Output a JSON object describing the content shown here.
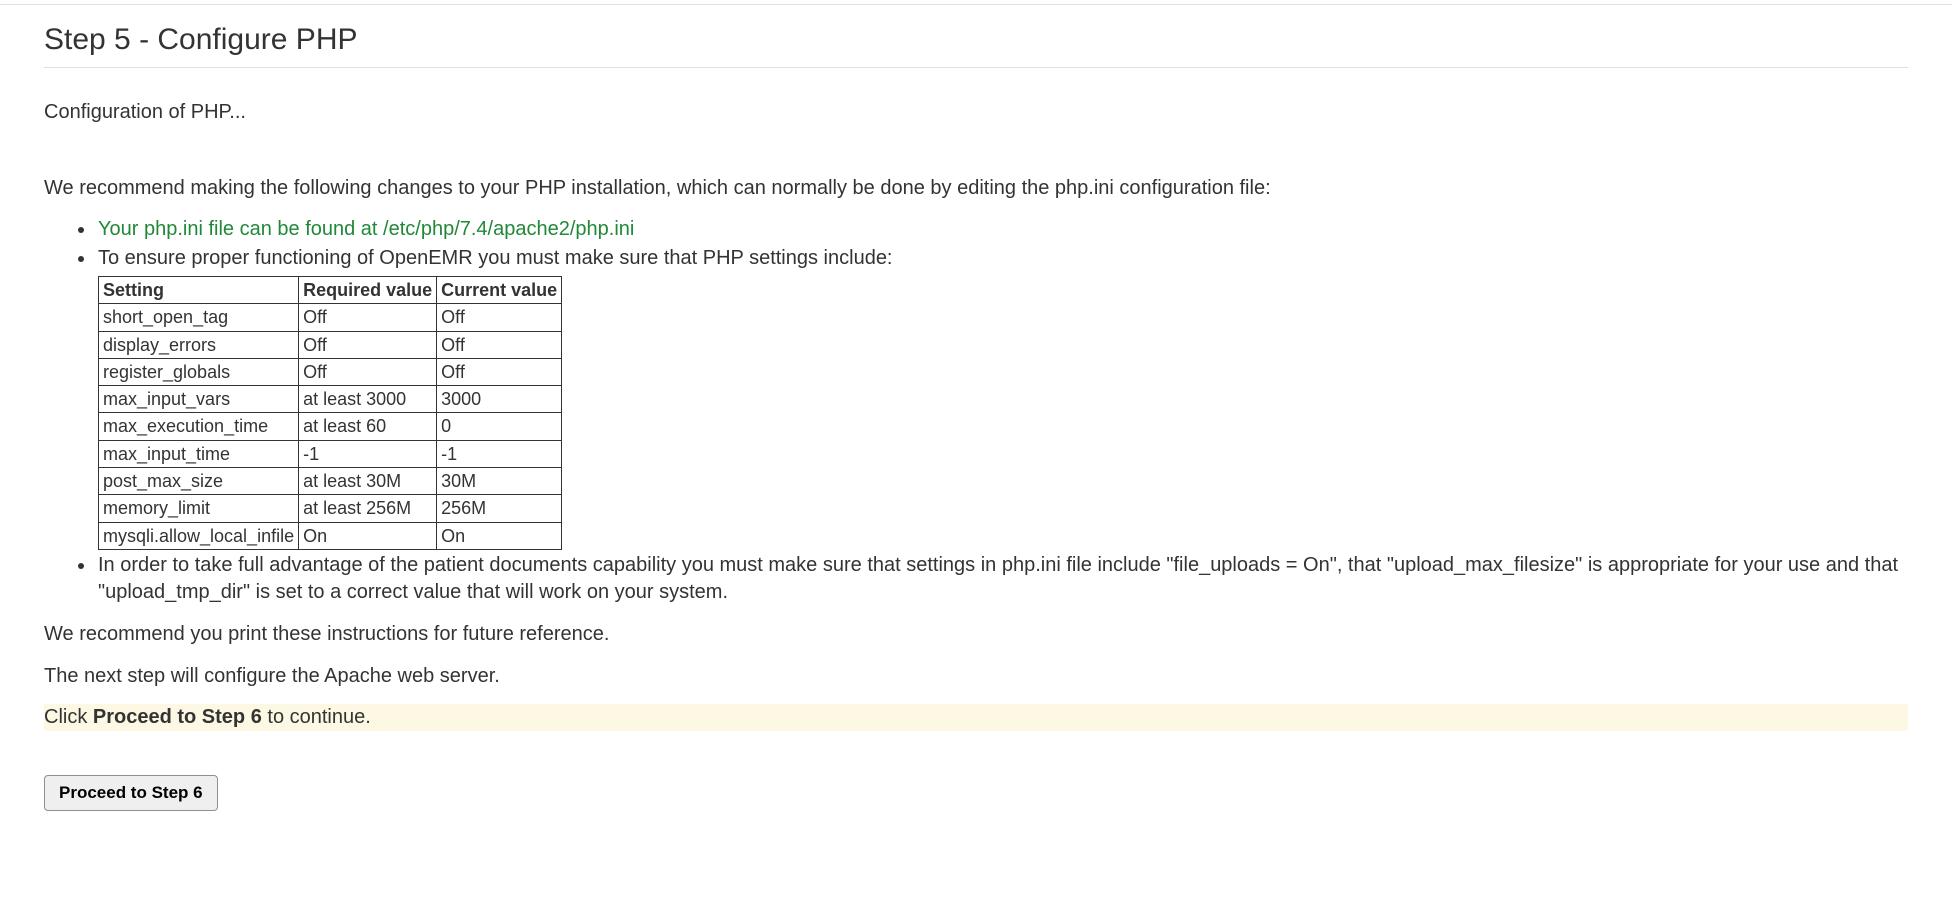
{
  "page_title": "Step 5 - Configure PHP",
  "intro_text": "Configuration of PHP...",
  "recommend_text": "We recommend making the following changes to your PHP installation, which can normally be done by editing the php.ini configuration file:",
  "list": {
    "item1": "Your php.ini file can be found at /etc/php/7.4/apache2/php.ini",
    "item2": "To ensure proper functioning of OpenEMR you must make sure that PHP settings include:",
    "item3": "In order to take full advantage of the patient documents capability you must make sure that settings in php.ini file include \"file_uploads = On\", that \"upload_max_filesize\" is appropriate for your use and that \"upload_tmp_dir\" is set to a correct value that will work on your system."
  },
  "table": {
    "headers": {
      "setting": "Setting",
      "required": "Required value",
      "current": "Current value"
    },
    "rows": [
      {
        "setting": "short_open_tag",
        "required": "Off",
        "current": "Off"
      },
      {
        "setting": "display_errors",
        "required": "Off",
        "current": "Off"
      },
      {
        "setting": "register_globals",
        "required": "Off",
        "current": "Off"
      },
      {
        "setting": "max_input_vars",
        "required": "at least 3000",
        "current": "3000"
      },
      {
        "setting": "max_execution_time",
        "required": "at least 60",
        "current": "0"
      },
      {
        "setting": "max_input_time",
        "required": "-1",
        "current": "-1"
      },
      {
        "setting": "post_max_size",
        "required": "at least 30M",
        "current": "30M"
      },
      {
        "setting": "memory_limit",
        "required": "at least 256M",
        "current": "256M"
      },
      {
        "setting": "mysqli.allow_local_infile",
        "required": "On",
        "current": "On"
      }
    ]
  },
  "print_text": "We recommend you print these instructions for future reference.",
  "next_step_text": "The next step will configure the Apache web server.",
  "proceed_line": {
    "prefix": "Click ",
    "bold": "Proceed to Step 6",
    "suffix": " to continue."
  },
  "proceed_button_label": "Proceed to Step 6"
}
